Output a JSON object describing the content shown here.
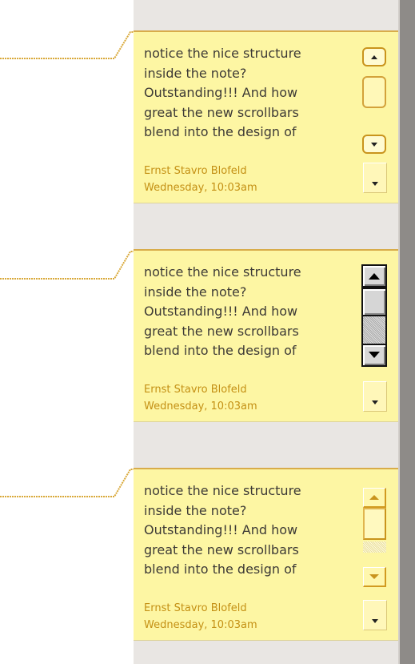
{
  "notes": [
    {
      "lines": [
        "notice the nice structure",
        "inside the note?",
        "Outstanding!!! And how",
        "great the new scrollbars",
        "blend into the design of"
      ],
      "author": "Ernst Stavro Blofeld",
      "date": "Wednesday, 10:03am",
      "scrollbar_style": "rounded-yellow"
    },
    {
      "lines": [
        "notice the nice structure",
        "inside the note?",
        "Outstanding!!! And how",
        "great the new scrollbars",
        "blend into the design of"
      ],
      "author": "Ernst Stavro Blofeld",
      "date": "Wednesday, 10:03am",
      "scrollbar_style": "classic-gray"
    },
    {
      "lines": [
        "notice the nice structure",
        "inside the note?",
        "Outstanding!!! And how",
        "great the new scrollbars",
        "blend into the design of"
      ],
      "author": "Ernst Stavro Blofeld",
      "date": "Wednesday, 10:03am",
      "scrollbar_style": "beveled-yellow"
    }
  ],
  "icons": {
    "scroll_up": "triangle-up-icon",
    "scroll_down": "triangle-down-icon",
    "more": "triangle-down-icon"
  },
  "colors": {
    "note_background": "#fdf6a3",
    "note_border": "#d8ac4a",
    "connector": "#d9a93a",
    "author_text": "#c49014",
    "body_text": "#3d3a36",
    "sidebar": "#e9e6e3"
  }
}
